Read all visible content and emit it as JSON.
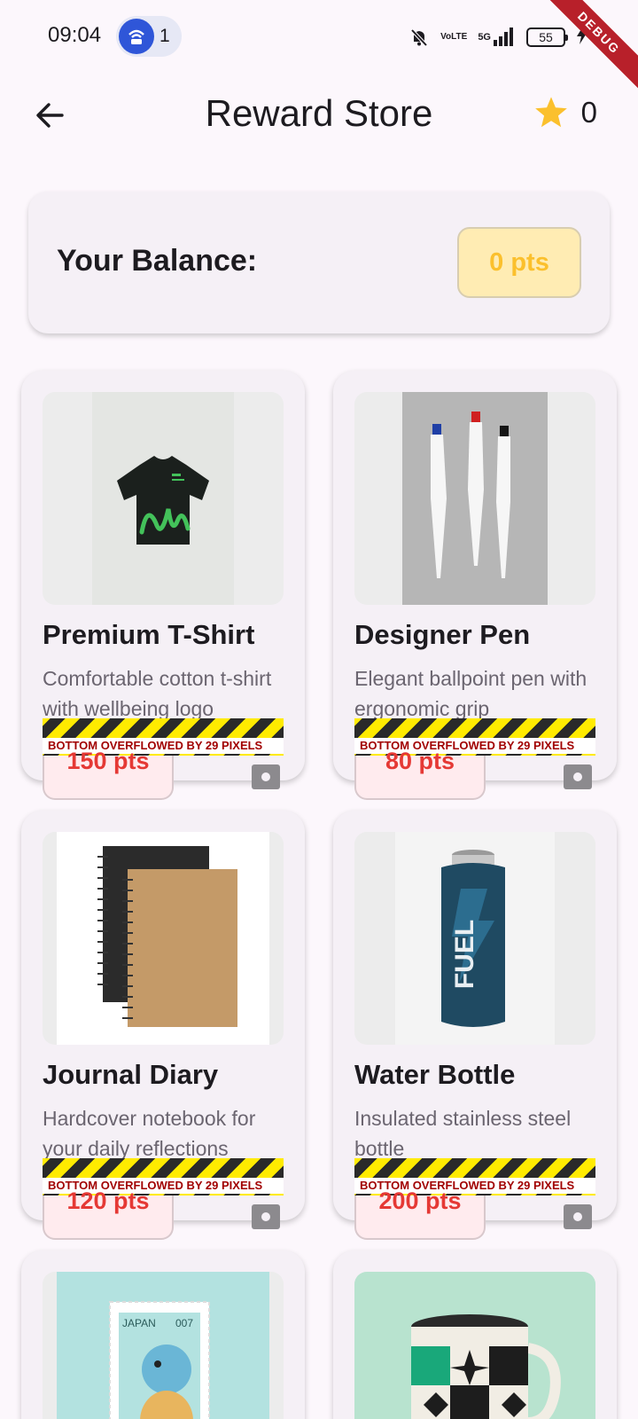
{
  "status_bar": {
    "time": "09:04",
    "hotspot_count": "1",
    "volte_top": "Vo",
    "volte_bottom": "LTE",
    "network": "5G",
    "battery": "55",
    "debug_label": "DEBUG",
    "icons": [
      "hotspot-icon",
      "bell-off-icon",
      "volte-icon",
      "signal-icon",
      "battery-icon",
      "charging-icon"
    ]
  },
  "app_bar": {
    "title": "Reward Store",
    "points": "0",
    "back_icon": "arrow-left-icon",
    "points_icon": "star-icon"
  },
  "balance": {
    "label": "Your Balance:",
    "value": "0 pts"
  },
  "overflow_warning": "BOTTOM OVERFLOWED BY 29 PIXELS",
  "products": [
    {
      "title": "Premium T-Shirt",
      "description": "Comfortable cotton t-shirt with wellbeing logo",
      "price": "150 pts"
    },
    {
      "title": "Designer Pen",
      "description": "Elegant ballpoint pen with ergonomic grip",
      "price": "80 pts"
    },
    {
      "title": "Journal Diary",
      "description": "Hardcover notebook for your daily reflections",
      "price": "120 pts"
    },
    {
      "title": "Water Bottle",
      "description": "Insulated stainless steel bottle",
      "price": "200 pts"
    }
  ],
  "stamp_text": {
    "country": "JAPAN",
    "code": "007"
  },
  "colors": {
    "background": "#fcf7fc",
    "card": "#f5f0f6",
    "balance_badge": "#ffecb3",
    "balance_text": "#fbc02d",
    "price_text": "#e53935",
    "star": "#fbc02d",
    "debug_ribbon": "#b8202a"
  }
}
